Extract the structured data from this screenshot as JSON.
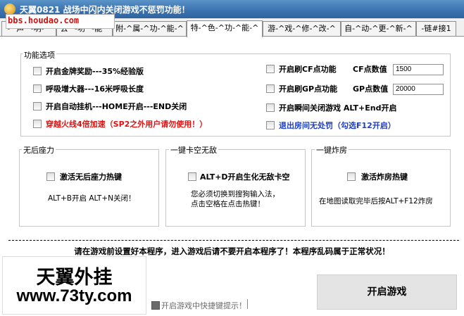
{
  "window": {
    "title": "天翼0821 战场中闪内关闭游戏不惩罚功能！",
    "site_overlay": "bbs.houdao.com"
  },
  "tabs": [
    {
      "label": "-^声^-明-^"
    },
    {
      "label": "去^-功^-能^"
    },
    {
      "label": "附-^属-^功-^能-^"
    },
    {
      "label": "特-^色-^功-^能-^"
    },
    {
      "label": "游-^戏-^修-^改-^"
    },
    {
      "label": "自-^动-^更-^新-^"
    },
    {
      "label": "-链#接1"
    }
  ],
  "features": {
    "title": "功能选项",
    "options": [
      {
        "label": "开启金牌奖励---35%经验版",
        "color": "#000000",
        "checked": false
      },
      {
        "label": "呼吸增大器---16米呼吸长度",
        "color": "#000000",
        "checked": false
      },
      {
        "label": "开启自动挂机---HOME开启---END关闭",
        "color": "#000000",
        "checked": false
      },
      {
        "label": "穿越火线4倍加速（SP2之外用户请勿使用！）",
        "color": "#e01010",
        "checked": false
      },
      {
        "label": "开启刷CF点功能",
        "color": "#000000",
        "checked": false
      },
      {
        "label": "开启刷GP点功能",
        "color": "#000000",
        "checked": false
      },
      {
        "label": "开启瞬间关闭游戏    ALT+End开启",
        "color": "#000000",
        "checked": false
      },
      {
        "label": "退出房间无处罚（勾选F12开启）",
        "color": "#1f3fc0",
        "checked": false
      }
    ],
    "cf_label": "CF点数值",
    "cf_value": "1500",
    "gp_label": "GP点数值",
    "gp_value": "20000"
  },
  "recoil": {
    "title": "无后座力",
    "checkbox": "激活无后座力热键",
    "checked": false,
    "hint": "ALT+B开启   ALT+N关闭！"
  },
  "stuck": {
    "title": "一键卡空无敌",
    "checkbox": "ALT+D开启生化无敌卡空",
    "checked": false,
    "hint1": "您必须切换到搜狗输入法，",
    "hint2": "点击空格在点击热键！"
  },
  "bomb": {
    "title": "一键炸房",
    "checkbox": "激活炸房热键",
    "checked": false,
    "hint": "在地图读取完毕后按ALT+F12炸房"
  },
  "notice": "请在游戏前设置好本程序，进入游戏后请不要开启本程序了！本程序乱码属于正常状况！",
  "brand": {
    "name": "天翼外挂",
    "url": "www.73ty.com"
  },
  "start_button": "开启游戏",
  "hotkey_hint": "开启游戏中快捷键提示！"
}
